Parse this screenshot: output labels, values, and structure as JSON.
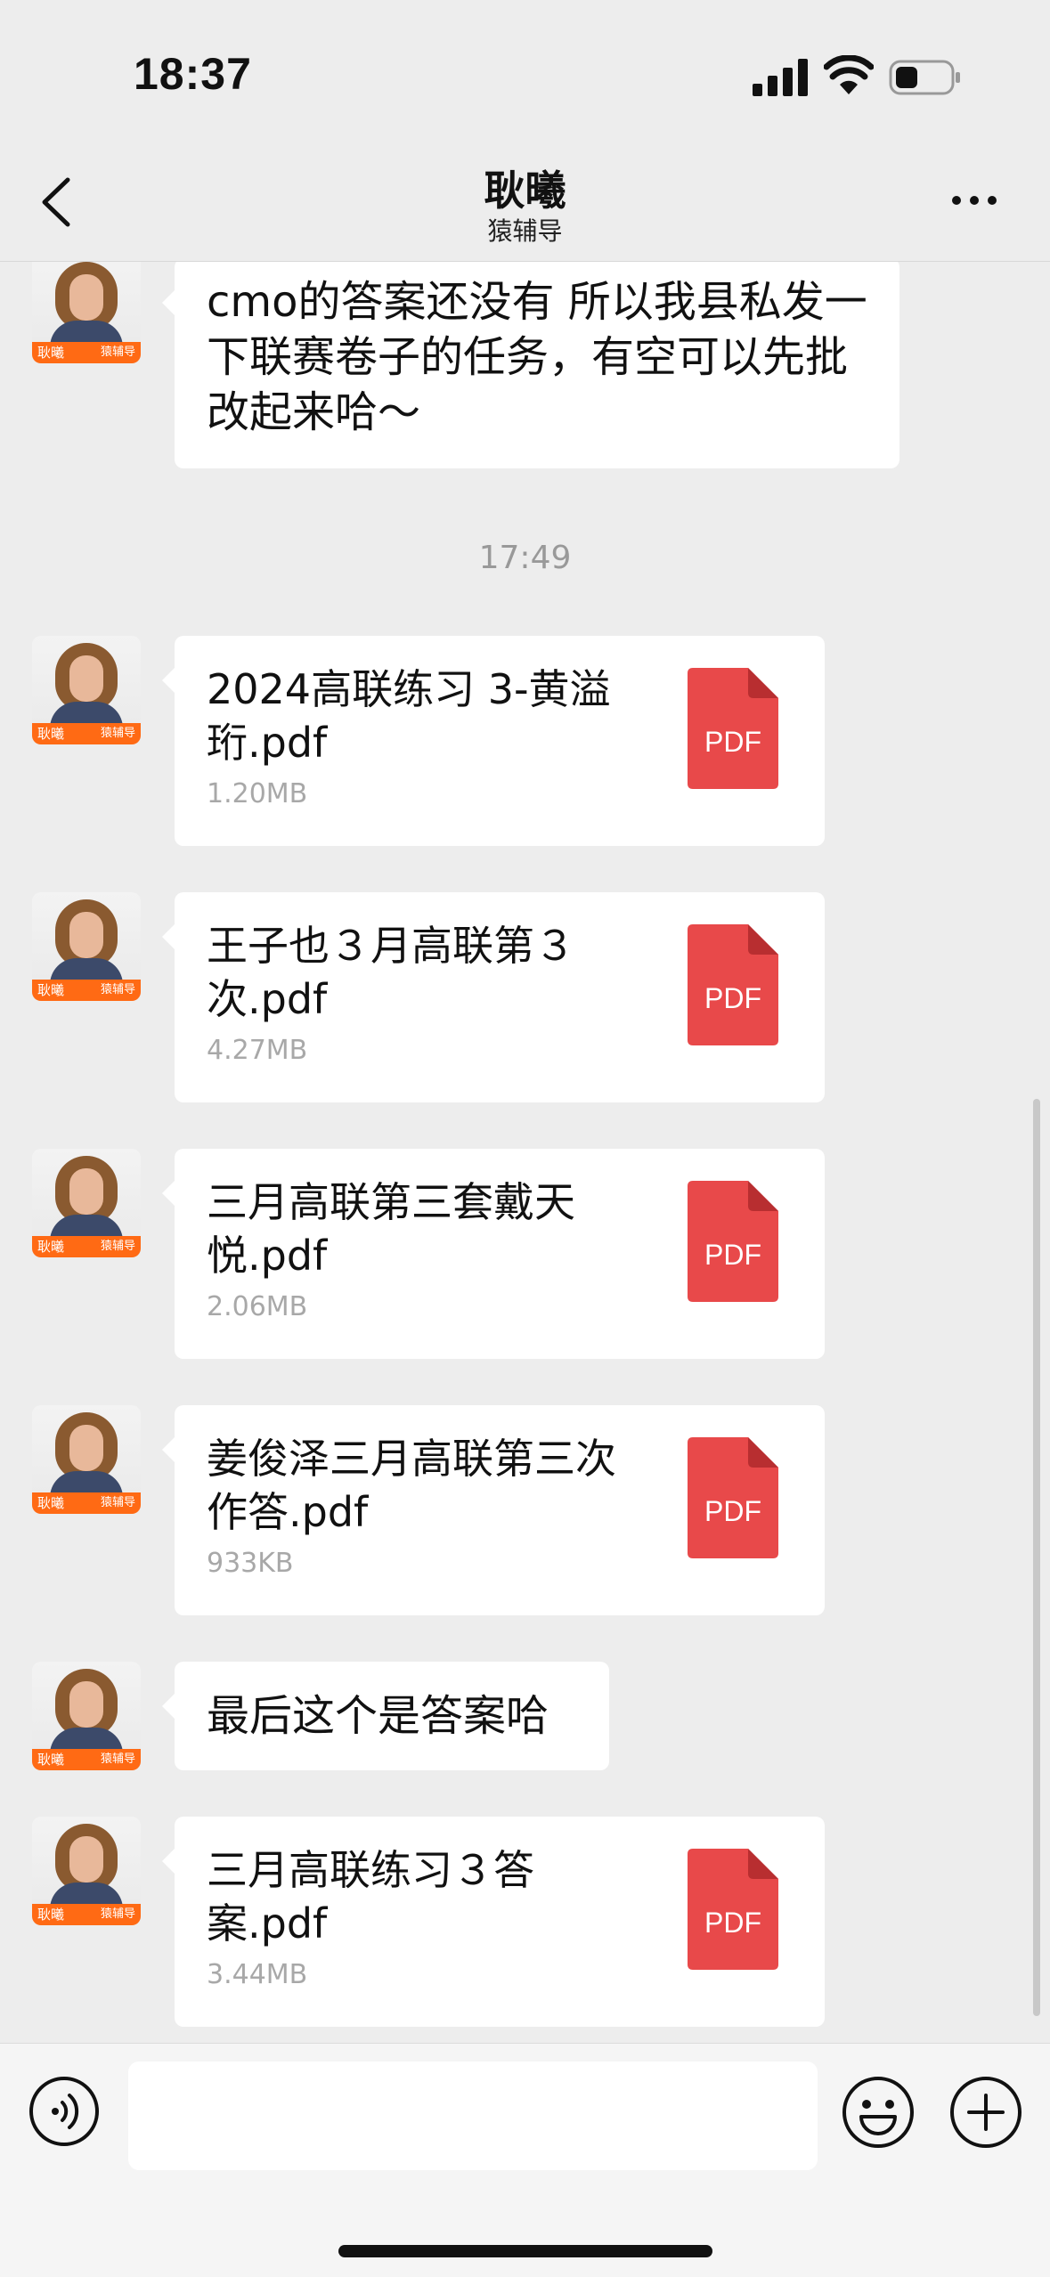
{
  "status": {
    "time": "18:37"
  },
  "nav": {
    "title": "耿曦",
    "subtitle": "猿辅导"
  },
  "avatar": {
    "name_tag": "耿曦",
    "brand_tag": "猿辅导"
  },
  "messages": [
    {
      "type": "text",
      "text": "cmo的答案还没有 所以我县私发一下联赛卷子的任务，有空可以先批改起来哈～"
    },
    {
      "type": "time",
      "text": "17:49"
    },
    {
      "type": "file",
      "name": "2024高联练习 3-黄溢珩.pdf",
      "size": "1.20MB",
      "icon_label": "PDF"
    },
    {
      "type": "file",
      "name": "王子也３月高联第３次.pdf",
      "size": "4.27MB",
      "icon_label": "PDF"
    },
    {
      "type": "file",
      "name": "三月高联第三套戴天悦.pdf",
      "size": "2.06MB",
      "icon_label": "PDF"
    },
    {
      "type": "file",
      "name": "姜俊泽三月高联第三次作答.pdf",
      "size": "933KB",
      "icon_label": "PDF"
    },
    {
      "type": "text",
      "text": "最后这个是答案哈"
    },
    {
      "type": "file",
      "name": "三月高联练习３答案.pdf",
      "size": "3.44MB",
      "icon_label": "PDF"
    }
  ],
  "input": {
    "placeholder": ""
  },
  "colors": {
    "background": "#ededed",
    "pdf_red": "#e8494a",
    "accent_orange": "#ff6a14"
  }
}
